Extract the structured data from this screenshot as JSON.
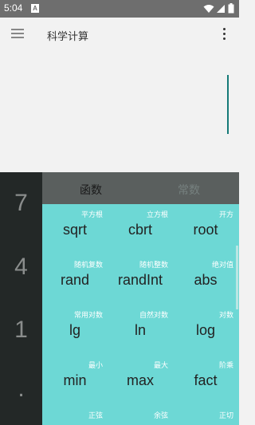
{
  "status_bar": {
    "time": "5:04",
    "badge": "A"
  },
  "app_bar": {
    "title": "科学计算"
  },
  "numbers": [
    "7",
    "4",
    "1",
    "."
  ],
  "tabs": {
    "active": "函数",
    "inactive": "常数"
  },
  "keys": [
    {
      "sub": "平方根",
      "main": "sqrt"
    },
    {
      "sub": "立方根",
      "main": "cbrt"
    },
    {
      "sub": "开方",
      "main": "root"
    },
    {
      "sub": "随机复数",
      "main": "rand"
    },
    {
      "sub": "随机整数",
      "main": "randInt"
    },
    {
      "sub": "绝对值",
      "main": "abs"
    },
    {
      "sub": "常用对数",
      "main": "lg"
    },
    {
      "sub": "自然对数",
      "main": "ln"
    },
    {
      "sub": "对数",
      "main": "log"
    },
    {
      "sub": "最小",
      "main": "min"
    },
    {
      "sub": "最大",
      "main": "max"
    },
    {
      "sub": "阶乘",
      "main": "fact"
    },
    {
      "sub": "正弦",
      "main": ""
    },
    {
      "sub": "余弦",
      "main": ""
    },
    {
      "sub": "正切",
      "main": ""
    }
  ],
  "icons": {
    "menu": "hamburger-menu-icon",
    "more": "more-vert-icon",
    "wifi": "wifi-icon",
    "signal": "cell-signal-icon",
    "battery": "battery-icon"
  }
}
